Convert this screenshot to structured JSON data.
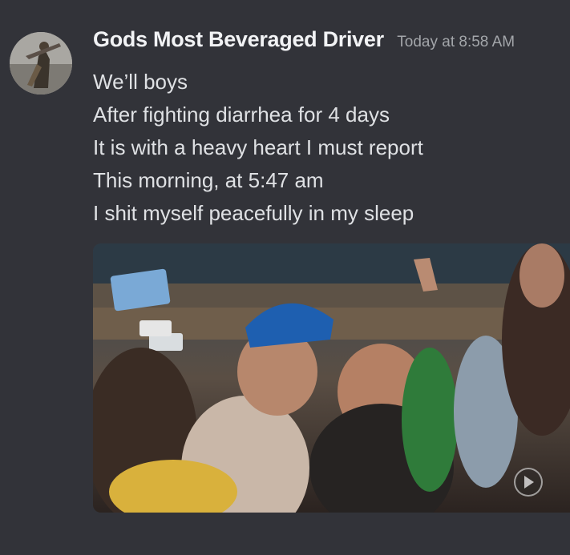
{
  "message": {
    "author": "Gods Most Beveraged Driver",
    "timestamp": "Today at 8:58 AM",
    "avatar_icon": "user-avatar-icon",
    "lines": [
      "We’ll boys",
      "After fighting diarrhea for 4 days",
      "It is with a heavy heart I must report",
      "This morning, at 5:47 am",
      "I shit myself peacefully in my sleep"
    ],
    "attachment": {
      "kind": "gif",
      "play_icon": "play-icon"
    }
  },
  "colors": {
    "background": "#323339",
    "username": "#f2f3f5",
    "timestamp": "#a3a6aa",
    "text": "#dfe1e4"
  }
}
